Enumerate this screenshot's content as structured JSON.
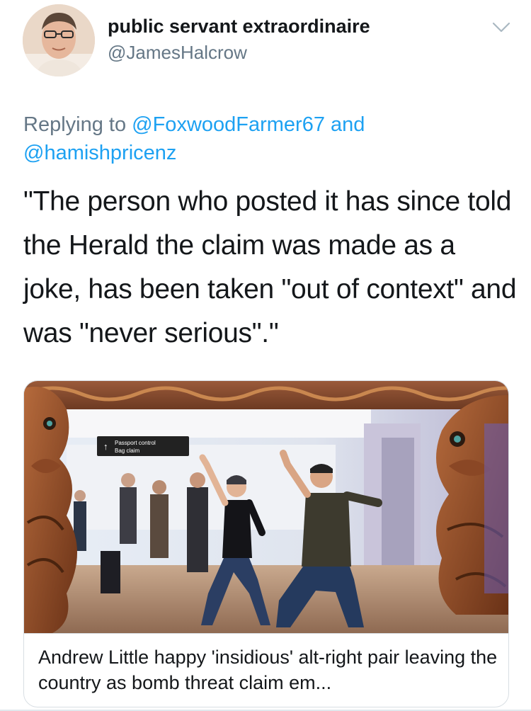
{
  "tweet": {
    "display_name": "public servant extraordinaire",
    "handle": "@JamesHalcrow",
    "reply_prefix": "Replying to ",
    "reply_mention_1": "@FoxwoodFarmer67",
    "reply_connector": " and",
    "reply_mention_2": "@hamishpricenz",
    "text": "\"The person who posted it has since told the Herald the claim was made as a joke, has been taken \"out of context\" and was \"never serious\".\""
  },
  "link_card": {
    "title": "Andrew Little happy 'insidious' alt-right pair leaving the country as bomb threat claim em...",
    "sign_line_1": "Passport control",
    "sign_line_2": "Bag claim"
  },
  "icons": {
    "menu": "chevron-down-icon",
    "avatar": "avatar"
  },
  "colors": {
    "link_blue": "#1da1f2",
    "secondary_gray": "#657786",
    "text": "#14171a",
    "border": "#d8dee3"
  }
}
